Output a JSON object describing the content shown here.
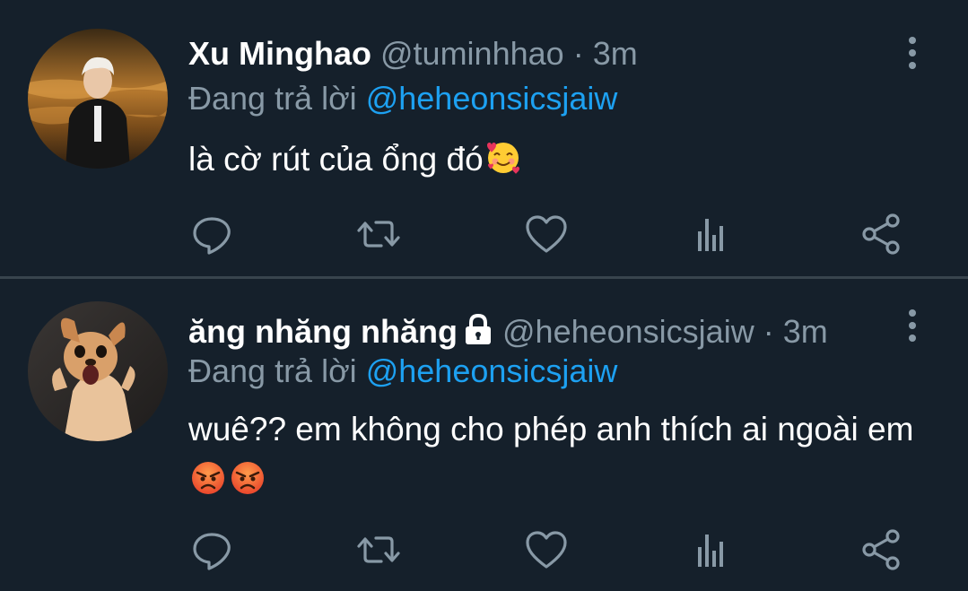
{
  "tweets": [
    {
      "author_name": "Xu Minghao",
      "handle": "@tuminhhao",
      "separator": "·",
      "time": "3m",
      "reply_prefix": "Đang trả lời",
      "reply_target": "@heheonsicsjaiw",
      "text": "là cờ rút của ổng đó",
      "text_emojis": [
        "smiling-face-with-hearts"
      ],
      "protected": false,
      "avatar": "photo-man-by-water"
    },
    {
      "author_name": "ăng nhăng nhăng",
      "handle": "@heheonsicsjaiw",
      "separator": "·",
      "time": "3m",
      "reply_prefix": "Đang trả lời",
      "reply_target": "@heheonsicsjaiw",
      "text": "wuê?? em không cho phép anh thích ai ngoài em",
      "text_emojis": [
        "angry-face",
        "angry-face"
      ],
      "protected": true,
      "avatar": "photo-surprised-dog"
    }
  ],
  "actions": [
    "reply-icon",
    "retweet-icon",
    "like-icon",
    "analytics-icon",
    "share-icon"
  ],
  "colors": {
    "background": "#15202b",
    "divider": "#38444d",
    "secondary_text": "#8899a6",
    "link": "#1da1f2",
    "icon": "#8899a6"
  }
}
